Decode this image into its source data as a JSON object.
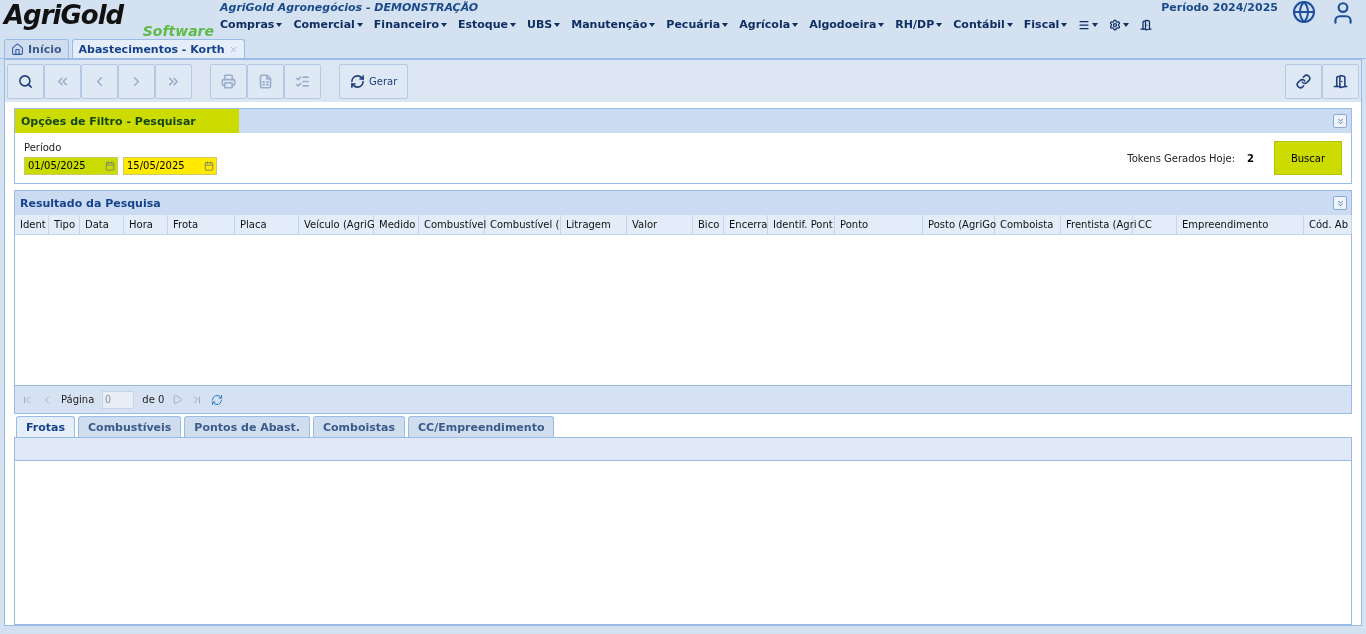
{
  "logo": {
    "name": "AgriGold",
    "tagline": "Software"
  },
  "company": "AgriGold Agronegócios - DEMONSTRAÇÃO",
  "period": "Período 2024/2025",
  "menu": [
    {
      "kind": "text",
      "label": "Compras"
    },
    {
      "kind": "text",
      "label": "Comercial"
    },
    {
      "kind": "text",
      "label": "Financeiro"
    },
    {
      "kind": "text",
      "label": "Estoque"
    },
    {
      "kind": "text",
      "label": "UBS"
    },
    {
      "kind": "text",
      "label": "Manutenção"
    },
    {
      "kind": "text",
      "label": "Pecuária"
    },
    {
      "kind": "text",
      "label": "Agrícola"
    },
    {
      "kind": "text",
      "label": "Algodoeira"
    },
    {
      "kind": "text",
      "label": "RH/DP"
    },
    {
      "kind": "text",
      "label": "Contábil"
    },
    {
      "kind": "text",
      "label": "Fiscal"
    },
    {
      "kind": "list"
    },
    {
      "kind": "settings"
    },
    {
      "kind": "exit"
    }
  ],
  "page_tabs": [
    {
      "label": "Início",
      "kind": "home",
      "selected": false
    },
    {
      "label": "Abastecimentos - Korth",
      "kind": "closable",
      "selected": true
    }
  ],
  "toolbar": [
    {
      "kind": "search",
      "disabled": false
    },
    {
      "kind": "first",
      "disabled": true
    },
    {
      "kind": "prev",
      "disabled": true
    },
    {
      "kind": "next",
      "disabled": true
    },
    {
      "kind": "last",
      "disabled": true
    },
    {
      "kind": "print",
      "disabled": true
    },
    {
      "kind": "excel",
      "disabled": true
    },
    {
      "kind": "checklist",
      "disabled": true
    },
    {
      "kind": "refresh",
      "label": "Gerar",
      "disabled": false
    }
  ],
  "filter": {
    "title": "Opções de Filtro - Pesquisar",
    "period_label": "Período",
    "date_from": "01/05/2025",
    "date_to": "15/05/2025",
    "tokens_label": "Tokens Gerados Hoje:",
    "tokens_value": "2",
    "search_button": "Buscar"
  },
  "results": {
    "title": "Resultado da Pesquisa",
    "columns": [
      "Ident",
      "Tipo",
      "Data",
      "Hora",
      "Frota",
      "Placa",
      "Veículo (AgriG",
      "Medido",
      "Combustível",
      "Combustível (",
      "Litragem",
      "Valor",
      "Bico",
      "Encerra",
      "Identif. Pont",
      "Ponto",
      "Posto (AgriGo",
      "Comboista",
      "Frentista (Agri",
      "CC",
      "Empreendimento",
      "Cód. Ab"
    ],
    "pager": {
      "page_label": "Página",
      "page_value": "0",
      "of_label": "de 0"
    }
  },
  "detail_tabs": [
    {
      "label": "Frotas",
      "selected": true
    },
    {
      "label": "Combustíveis",
      "selected": false
    },
    {
      "label": "Pontos de Abast.",
      "selected": false
    },
    {
      "label": "Comboistas",
      "selected": false
    },
    {
      "label": "CC/Empreendimento",
      "selected": false
    }
  ]
}
